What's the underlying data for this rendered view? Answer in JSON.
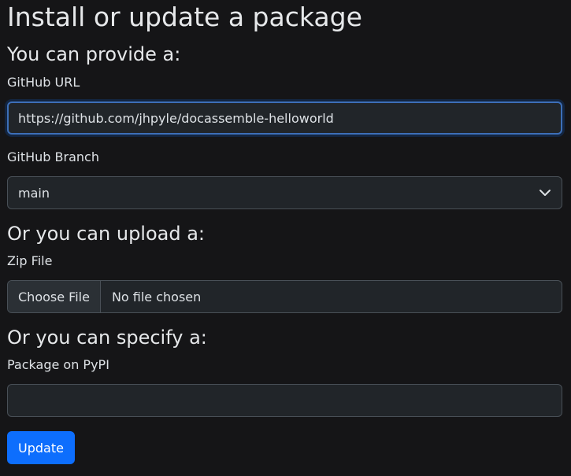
{
  "page": {
    "title": "Install or update a package"
  },
  "github": {
    "heading": "You can provide a:",
    "url_label": "GitHub URL",
    "url_value": "https://github.com/jhpyle/docassemble-helloworld",
    "branch_label": "GitHub Branch",
    "branch_selected": "main"
  },
  "upload": {
    "heading": "Or you can upload a:",
    "zip_label": "Zip File",
    "choose_button": "Choose File",
    "no_file_text": "No file chosen"
  },
  "pypi": {
    "heading": "Or you can specify a:",
    "package_label": "Package on PyPI",
    "package_value": ""
  },
  "actions": {
    "update_label": "Update"
  },
  "icons": {
    "select_arrow": "chevron-down-icon"
  },
  "colors": {
    "background": "#151517",
    "accent": "#0d6efd",
    "focus_border": "#3d6fb8"
  }
}
